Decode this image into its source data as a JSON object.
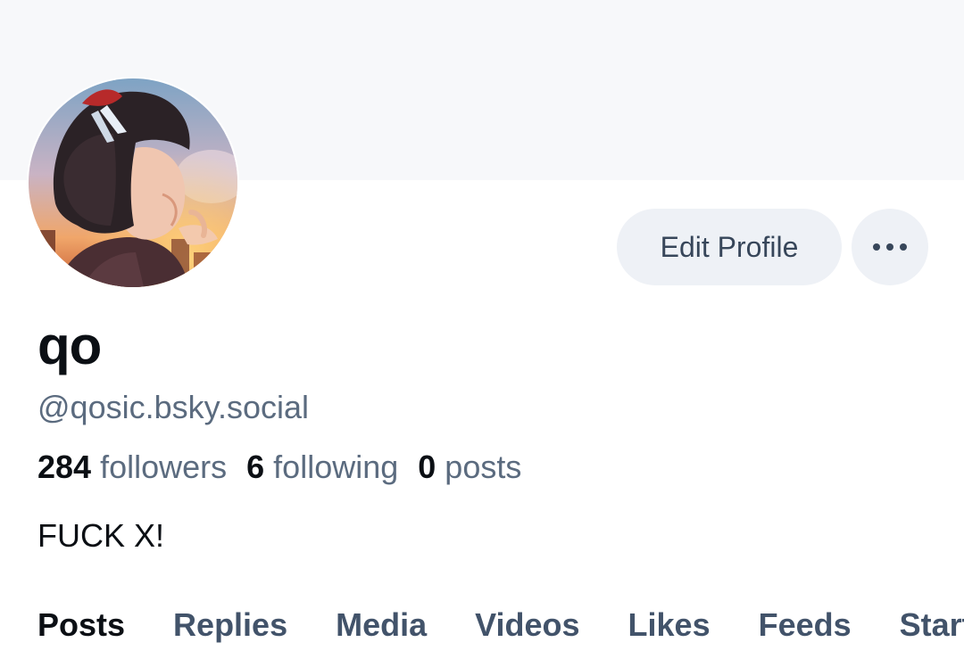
{
  "profile": {
    "display_name": "qo",
    "handle": "@qosic.bsky.social",
    "bio": "FUCK X!",
    "avatar": "anime-girl-sunset-avatar"
  },
  "actions": {
    "edit_profile_label": "Edit Profile",
    "more_icon": "ellipsis-icon"
  },
  "stats": {
    "followers_count": "284",
    "followers_label": "followers",
    "following_count": "6",
    "following_label": "following",
    "posts_count": "0",
    "posts_label": "posts"
  },
  "tabs": [
    {
      "label": "Posts",
      "active": true
    },
    {
      "label": "Replies",
      "active": false
    },
    {
      "label": "Media",
      "active": false
    },
    {
      "label": "Videos",
      "active": false
    },
    {
      "label": "Likes",
      "active": false
    },
    {
      "label": "Feeds",
      "active": false
    },
    {
      "label": "Starter Packs",
      "active": false
    }
  ],
  "colors": {
    "banner": "#f7f8fa",
    "button_bg": "#eef1f6",
    "muted_text": "#5b6b7f",
    "tab_text": "#42536a"
  }
}
